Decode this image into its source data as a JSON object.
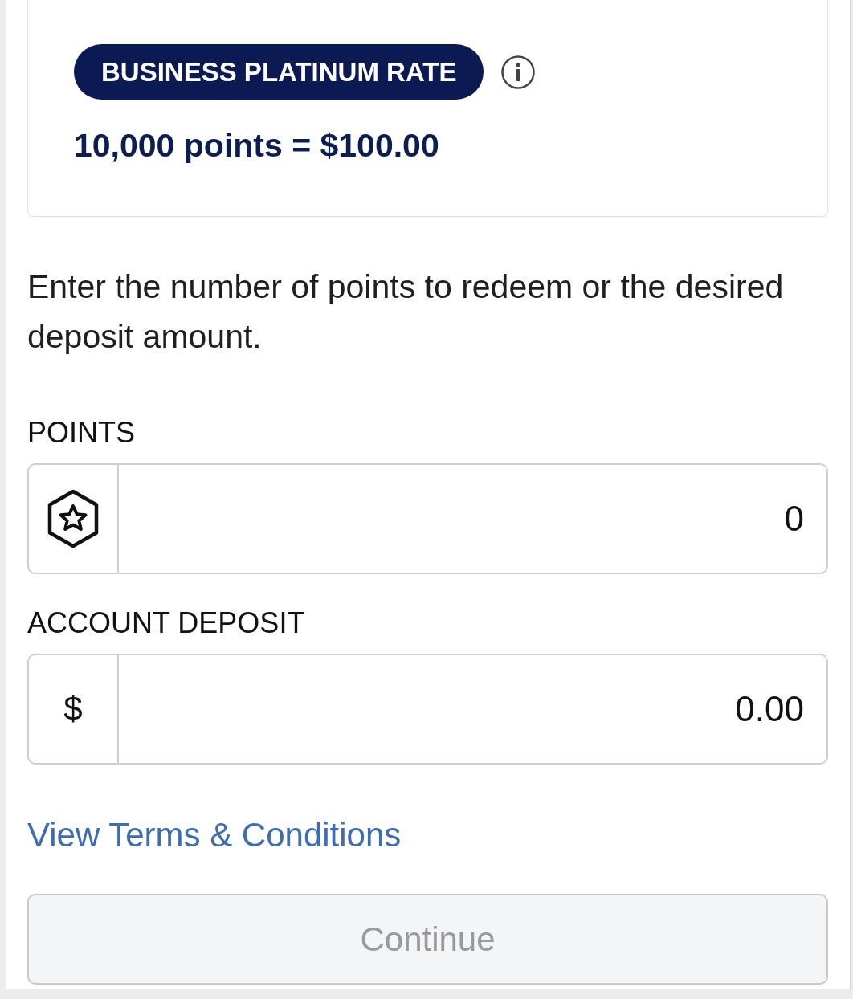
{
  "rate_card": {
    "badge": "BUSINESS PLATINUM RATE",
    "rate": "10,000 points = $100.00"
  },
  "instructions": "Enter the number of points to redeem or the desired deposit amount.",
  "fields": [
    {
      "kind": "points",
      "label": "POINTS",
      "value": "0"
    },
    {
      "kind": "currency",
      "label": "ACCOUNT DEPOSIT",
      "prefix": "$",
      "value": "0.00"
    }
  ],
  "terms_link": "View Terms & Conditions",
  "continue_button": {
    "label": "Continue",
    "disabled": true
  }
}
